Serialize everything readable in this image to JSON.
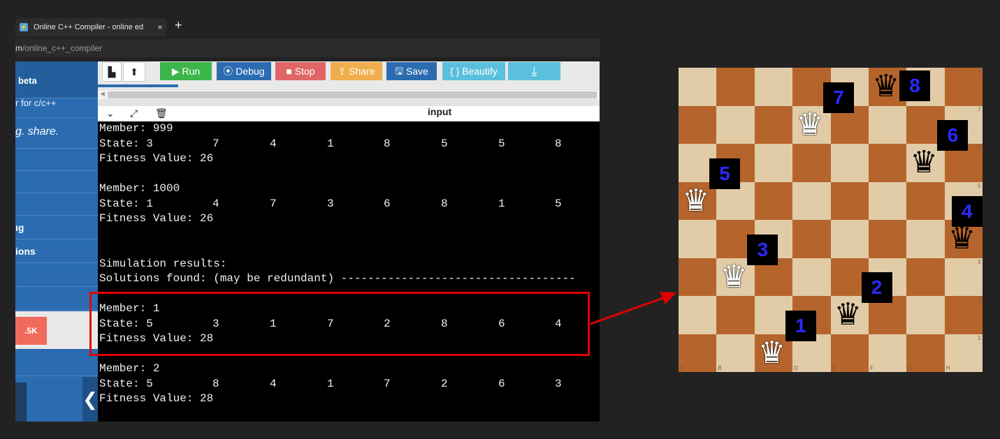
{
  "browser": {
    "tab_title": "Online C++ Compiler - online ed",
    "tab_close": "×",
    "new_tab": "+",
    "url_domain": "m",
    "url_path": "/online_c++_compiler"
  },
  "sidebar": {
    "beta": "beta",
    "tagline": "r for c/c++",
    "slogan": "g. share.",
    "item_1": "ıg",
    "item_2": "ions",
    "ad_badge": ".5K",
    "collapse": "❮"
  },
  "toolbar": {
    "run": "▶ Run",
    "debug": "⦿ Debug",
    "stop": "■ Stop",
    "share": "⇪ Share",
    "save": "🖫 Save",
    "beautify": "{ } Beautify",
    "download": "⤓"
  },
  "input_label": "input",
  "console": {
    "lines": [
      {
        "text": "Member: 999"
      },
      {
        "label": "State: 3",
        "nums": [
          "7",
          "4",
          "1",
          "8",
          "5",
          "5",
          "8"
        ]
      },
      {
        "text": "Fitness Value: 26"
      },
      {
        "text": ""
      },
      {
        "text": "Member: 1000"
      },
      {
        "label": "State: 1",
        "nums": [
          "4",
          "7",
          "3",
          "6",
          "8",
          "1",
          "5"
        ]
      },
      {
        "text": "Fitness Value: 26"
      },
      {
        "text": ""
      },
      {
        "text": ""
      },
      {
        "text": "Simulation results:"
      },
      {
        "text": "Solutions found: (may be redundant) -----------------------------------"
      },
      {
        "text": ""
      },
      {
        "text": "Member: 1"
      },
      {
        "label": "State: 5",
        "nums": [
          "3",
          "1",
          "7",
          "2",
          "8",
          "6",
          "4"
        ]
      },
      {
        "text": "Fitness Value: 28"
      },
      {
        "text": ""
      },
      {
        "text": "Member: 2"
      },
      {
        "label": "State: 5",
        "nums": [
          "8",
          "4",
          "1",
          "7",
          "2",
          "6",
          "3"
        ]
      },
      {
        "text": "Fitness Value: 28"
      }
    ]
  },
  "chessboard": {
    "files": [
      "A",
      "B",
      "C",
      "D",
      "E",
      "F",
      "G",
      "H"
    ],
    "ranks": [
      "1",
      "2",
      "3",
      "4",
      "5",
      "6",
      "7",
      "8"
    ],
    "queen_glyph": "♛",
    "queens": [
      {
        "label": "1",
        "file": "C",
        "rank": "1",
        "color": "white"
      },
      {
        "label": "2",
        "file": "E",
        "rank": "2",
        "color": "black"
      },
      {
        "label": "3",
        "file": "B",
        "rank": "3",
        "color": "white"
      },
      {
        "label": "4",
        "file": "H",
        "rank": "4",
        "color": "black"
      },
      {
        "label": "5",
        "file": "A",
        "rank": "5",
        "color": "white"
      },
      {
        "label": "6",
        "file": "G",
        "rank": "6",
        "color": "black"
      },
      {
        "label": "7",
        "file": "D",
        "rank": "7",
        "color": "white"
      },
      {
        "label": "8",
        "file": "F",
        "rank": "8",
        "color": "black"
      }
    ]
  },
  "colors": {
    "highlight": "#e10000",
    "run": "#3cb54a",
    "debug": "#2b6cb0",
    "stop": "#e06666",
    "share": "#f0ad4e",
    "save": "#2b6cb0",
    "beautify": "#5bc0de",
    "download": "#5bc0de"
  }
}
